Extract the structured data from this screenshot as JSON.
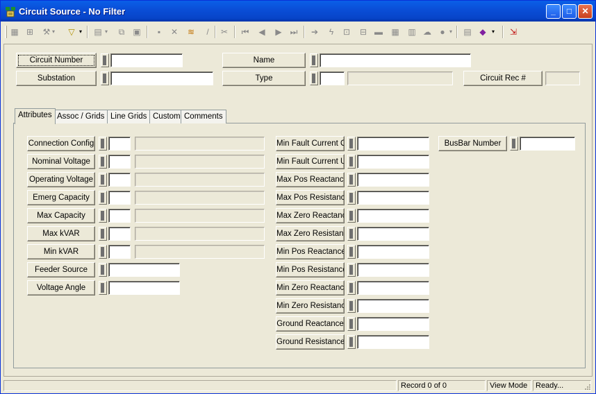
{
  "window": {
    "title": "Circuit Source - No Filter",
    "controls": {
      "minimize": "_",
      "maximize": "□",
      "close": "✕"
    }
  },
  "toolbar": {
    "icons": [
      "grid-icon",
      "find-icon",
      "tools-icon",
      "filter-icon",
      "page-icon",
      "copy-icon",
      "paste-icon",
      "save-icon",
      "delete-icon",
      "stack-icon",
      "edit-icon",
      "cut-icon",
      "first-icon",
      "prev-icon",
      "next-icon",
      "last-icon",
      "goto-icon",
      "lightning-icon",
      "report-icon",
      "tree-icon",
      "list-icon",
      "calc-icon",
      "chart-icon",
      "cloud-icon",
      "search-icon",
      "table-icon",
      "book-icon",
      "exit-icon"
    ]
  },
  "header": {
    "circuit_number_label": "Circuit Number",
    "circuit_number_value": "",
    "substation_label": "Substation",
    "substation_value": "",
    "name_label": "Name",
    "name_value": "",
    "type_label": "Type",
    "type_code": "",
    "type_desc": "",
    "circuit_rec_label": "Circuit Rec #",
    "circuit_rec_value": ""
  },
  "tabs": [
    "Attributes",
    "Assoc / Grids",
    "Line Grids",
    "Custom",
    "Comments"
  ],
  "active_tab": "Attributes",
  "attributes": {
    "left": [
      {
        "label": "Connection Config",
        "code": "",
        "desc": ""
      },
      {
        "label": "Nominal Voltage",
        "code": "",
        "desc": ""
      },
      {
        "label": "Operating Voltage",
        "code": "",
        "desc": ""
      },
      {
        "label": "Emerg Capacity",
        "code": "",
        "desc": ""
      },
      {
        "label": "Max Capacity",
        "code": "",
        "desc": ""
      },
      {
        "label": "Max kVAR",
        "code": "",
        "desc": ""
      },
      {
        "label": "Min kVAR",
        "code": "",
        "desc": ""
      },
      {
        "label": "Feeder Source",
        "value": ""
      },
      {
        "label": "Voltage Angle",
        "value": ""
      }
    ],
    "middle": [
      {
        "label": "Min Fault Current OH",
        "value": ""
      },
      {
        "label": "Min Fault Current UG",
        "value": ""
      },
      {
        "label": "Max Pos Reactance",
        "value": ""
      },
      {
        "label": "Max Pos Resistance",
        "value": ""
      },
      {
        "label": "Max Zero Reactance",
        "value": ""
      },
      {
        "label": "Max Zero Resistance",
        "value": ""
      },
      {
        "label": "Min Pos Reactance",
        "value": ""
      },
      {
        "label": "Min Pos Resistance",
        "value": ""
      },
      {
        "label": "Min Zero Reactance",
        "value": ""
      },
      {
        "label": "Min Zero Resistance",
        "value": ""
      },
      {
        "label": "Ground Reactance",
        "value": ""
      },
      {
        "label": "Ground Resistance",
        "value": ""
      }
    ],
    "right": [
      {
        "label": "BusBar Number",
        "value": ""
      }
    ]
  },
  "status": {
    "record": "Record 0 of 0",
    "mode": "View Mode",
    "state": "Ready..."
  }
}
